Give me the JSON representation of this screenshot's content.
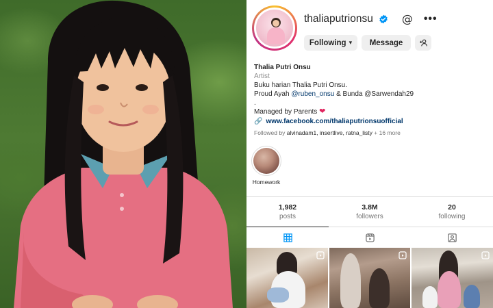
{
  "profile": {
    "username": "thaliaputrionsu",
    "buttons": {
      "following": "Following",
      "message": "Message"
    },
    "full_name": "Thalia Putri Onsu",
    "category": "Artist",
    "bio_line1": "Buku harian Thalia Putri Onsu.",
    "bio_line2_prefix": "Proud Ayah ",
    "bio_mention": "@ruben_onsu",
    "bio_line2_suffix": " & Bunda @Sarwendah29",
    "bio_dot": ".",
    "bio_line3": "Managed by Parents",
    "link": "www.facebook.com/thaliaputrionsuofficial",
    "followed_by_prefix": "Followed by ",
    "followed_by_names": "alvinadam1, insertlive, ratna_listy",
    "followed_by_suffix": " + 16 more"
  },
  "highlights": [
    {
      "label": "Homework"
    }
  ],
  "stats": [
    {
      "value": "1,982",
      "label": "posts"
    },
    {
      "value": "3.8M",
      "label": "followers"
    },
    {
      "value": "20",
      "label": "following"
    }
  ],
  "icons": {
    "verified": "verified-badge-icon",
    "threads": "threads-icon",
    "more": "more-options-icon",
    "add_user": "add-user-icon",
    "link": "link-icon",
    "heart": "heart-icon",
    "grid_tab": "posts-grid-icon",
    "reels_tab": "reels-icon",
    "tagged_tab": "tagged-icon"
  },
  "colors": {
    "verified_blue": "#0095f6",
    "link_blue": "#00376b",
    "heart_red": "#e0245e",
    "button_gray": "#efefef"
  }
}
